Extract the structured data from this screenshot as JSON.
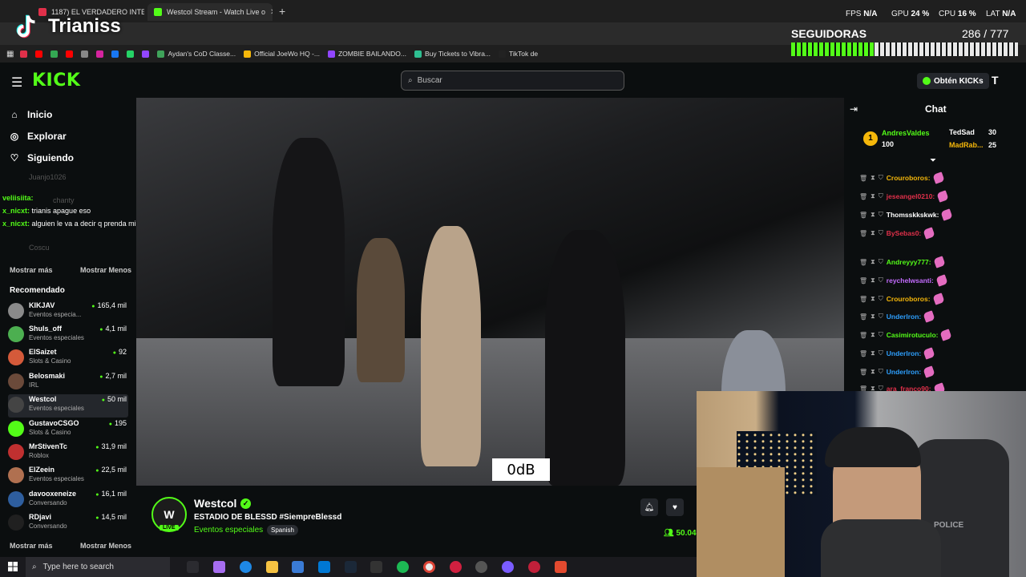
{
  "browser": {
    "tabs": [
      {
        "title": "1187) EL VERDADERO INTER"
      },
      {
        "title": "Westcol Stream - Watch Live o"
      }
    ],
    "bookmarks": [
      "Aydan's CoD Classe...",
      "Official JoeWo HQ -...",
      "ZOMBIE BAILANDO...",
      "Buy Tickets to Vibra...",
      "TikTok de"
    ],
    "perf": {
      "fps_label": "FPS",
      "fps": "N/A",
      "gpu_label": "GPU",
      "gpu": "24 %",
      "cpu_label": "CPU",
      "cpu": "16 %",
      "lat_label": "LAT",
      "lat": "N/A"
    }
  },
  "overlay": {
    "streamer": "Trianiss",
    "followers_label": "SEGUIDORAS",
    "followers_count": "286 / 777",
    "followers_progress": 0.368
  },
  "kick": {
    "logo": "KICK",
    "search_placeholder": "Buscar",
    "get_kicks": "Obtén KICKs"
  },
  "sidebar": {
    "nav": [
      {
        "label": "Inicio",
        "icon": "home-icon"
      },
      {
        "label": "Explorar",
        "icon": "compass-icon"
      },
      {
        "label": "Siguiendo",
        "icon": "heart-icon"
      }
    ],
    "faded_following": [
      "Juanjo1026",
      "chanty",
      "Coscu"
    ],
    "chat_overlay": [
      {
        "user": "veliisiita:",
        "text": ""
      },
      {
        "user": "x_nicxt:",
        "text": "trianis apague eso"
      },
      {
        "user": "x_nicxt:",
        "text": "alguien le va a decir q prenda microfono?"
      }
    ],
    "show_more": "Mostrar más",
    "show_less": "Mostrar Menos",
    "recommended_title": "Recomendado",
    "recommended": [
      {
        "name": "KIKJAV",
        "category": "Eventos especia...",
        "viewers": "165,4 mil",
        "color": "#8a8a8a"
      },
      {
        "name": "Shuls_off",
        "category": "Eventos especiales",
        "viewers": "4,1 mil",
        "color": "#4caf50"
      },
      {
        "name": "ElSaizet",
        "category": "Slots & Casino",
        "viewers": "92",
        "color": "#d45a3a"
      },
      {
        "name": "Belosmaki",
        "category": "IRL",
        "viewers": "2,7 mil",
        "color": "#6b4a3a"
      },
      {
        "name": "Westcol",
        "category": "Eventos especiales",
        "viewers": "50 mil",
        "color": "#444444"
      },
      {
        "name": "GustavoCSGO",
        "category": "Slots & Casino",
        "viewers": "195",
        "color": "#53fc18"
      },
      {
        "name": "MrStivenTc",
        "category": "Roblox",
        "viewers": "31,9 mil",
        "color": "#c03030"
      },
      {
        "name": "ElZeein",
        "category": "Eventos especiales",
        "viewers": "22,5 mil",
        "color": "#b07050"
      },
      {
        "name": "davooxeneize",
        "category": "Conversando",
        "viewers": "16,1 mil",
        "color": "#2e5e9e"
      },
      {
        "name": "RDjavi",
        "category": "Conversando",
        "viewers": "14,5 mil",
        "color": "#202020"
      }
    ]
  },
  "stream": {
    "streamer": "Westcol",
    "title": "ESTADIO DE BLESSD #SiempreBlessd",
    "category": "Eventos especiales",
    "language": "Spanish",
    "live": "LIVE",
    "viewers": "50.04",
    "audio_meter": "0dB"
  },
  "chat": {
    "title": "Chat",
    "gifters": [
      {
        "name": "AndresValdes",
        "amount": "100"
      },
      {
        "name": "TedSad",
        "amount": "30"
      },
      {
        "name": "MadRab...",
        "amount": "25"
      }
    ],
    "messages": [
      {
        "user": "Crouroboros:",
        "color": "#f5b70a"
      },
      {
        "user": "jeseangel0210:",
        "color": "#e0304a"
      },
      {
        "user": "Thomsskkskwk:",
        "color": "#ffffff"
      },
      {
        "user": "BySebas0:",
        "color": "#e0304a"
      },
      {
        "user": "Andreyyy777:",
        "color": "#53fc18"
      },
      {
        "user": "reychelwsanti:",
        "color": "#c46cff"
      },
      {
        "user": "Crouroboros:",
        "color": "#f5b70a"
      },
      {
        "user": "Underlron:",
        "color": "#2ea0ff"
      },
      {
        "user": "Casimirotuculo:",
        "color": "#53fc18"
      },
      {
        "user": "Underlron:",
        "color": "#2ea0ff"
      },
      {
        "user": "Underlron:",
        "color": "#2ea0ff"
      },
      {
        "user": "ara_franco90:",
        "color": "#e0304a"
      }
    ]
  },
  "webcam": {
    "chair_brand": "POLICE"
  },
  "taskbar": {
    "search_placeholder": "Type here to search"
  }
}
